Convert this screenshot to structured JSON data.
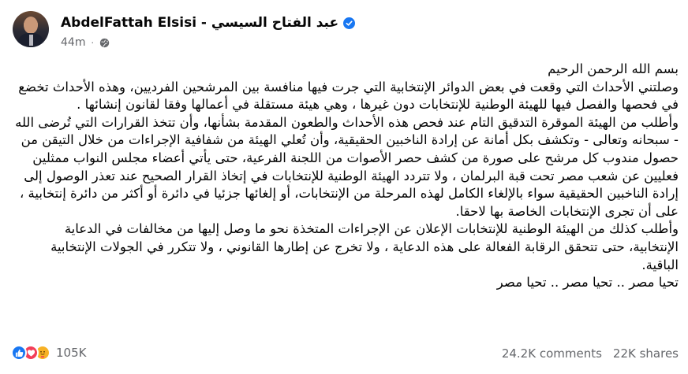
{
  "post": {
    "author": "AbdelFattah Elsisi - عبد الفتاح السيسي",
    "time": "44m",
    "separator": "·",
    "paragraphs": [
      "بسم الله الرحمن الرحيم",
      "وصلتني الأحداث التي وقعت في بعض الدوائر الإنتخابية التي جرت فيها منافسة بين المرشحين الفرديين، وهذه الأحداث تخضع في فحصها والفصل فيها للهيئة الوطنية للإنتخابات دون غيرها ، وهي هيئة مستقلة في أعمالها وفقا لقانون إنشائها .",
      "وأطلب من الهيئة الموقرة التدقيق التام عند فحص هذه الأحداث والطعون المقدمة بشأنها، وأن تتخذ القرارات التي تُرضى الله - سبحانه وتعالى - وتكشف بكل أمانة عن إرادة الناخبين الحقيقية، وأن تُعلي الهيئة من شفافية الإجراءات من خلال التيقن من حصول مندوب كل مرشح على صورة من كشف حصر الأصوات من اللجنة الفرعية، حتى يأتي أعضاء مجلس النواب ممثلين فعليين عن شعب مصر تحت قبة البرلمان ، ولا تتردد الهيئة الوطنية للإنتخابات في إتخاذ القرار الصحيح عند تعذر الوصول إلى إرادة الناخبين الحقيقية سواء بالإلغاء الكامل لهذه المرحلة من الإنتخابات، أو إلغائها جزئيا في دائرة أو أكثر من دائرة إنتخابية ، على أن تجرى الإنتخابات الخاصة بها لاحقا.",
      "وأطلب كذلك من الهيئة الوطنية للإنتخابات الإعلان عن الإجراءات المتخذة نحو ما وصل إليها من مخالفات في الدعاية الإنتخابية، حتى تتحقق الرقابة الفعالة على هذه الدعاية ، ولا تخرج عن إطارها القانوني ، ولا تتكرر في الجولات الإنتخابية الباقية.",
      "تحيا مصر .. تحيا مصر .. تحيا مصر"
    ]
  },
  "footer": {
    "reaction_count": "105K",
    "comments": "24.2K comments",
    "shares": "22K shares",
    "reactions": [
      "like-icon",
      "love-icon",
      "care-icon"
    ]
  },
  "colors": {
    "verified": "#1877f2",
    "meta": "#65676b",
    "like": "#1877f2",
    "love": "#f33e58",
    "care": "#f7b125"
  }
}
